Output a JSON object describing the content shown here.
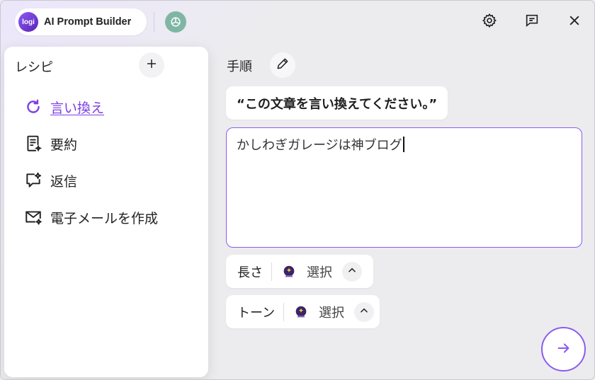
{
  "app": {
    "logo_text": "logi",
    "title": "AI Prompt Builder",
    "accent_color": "#8a5cf0"
  },
  "titlebar": {
    "icons": [
      "chatgpt-icon",
      "gear-icon",
      "feedback-icon",
      "close-icon"
    ]
  },
  "sidebar": {
    "title": "レシピ",
    "add_icon": "plus-icon",
    "items": [
      {
        "label": "言い換え",
        "icon": "rephrase-icon",
        "active": true
      },
      {
        "label": "要約",
        "icon": "summary-icon",
        "active": false
      },
      {
        "label": "返信",
        "icon": "reply-icon",
        "active": false
      },
      {
        "label": "電子メールを作成",
        "icon": "email-compose-icon",
        "active": false
      }
    ]
  },
  "main": {
    "step_label": "手順",
    "edit_icon": "pencil-icon",
    "prompt": "“この文章を言い換えてください。”",
    "input_value": "かしわぎガレージは神ブログ",
    "options": [
      {
        "name": "長さ",
        "value": "選択",
        "icon": "crystal-ball-icon"
      },
      {
        "name": "トーン",
        "value": "選択",
        "icon": "crystal-ball-icon"
      }
    ],
    "send_icon": "arrow-right-icon"
  }
}
